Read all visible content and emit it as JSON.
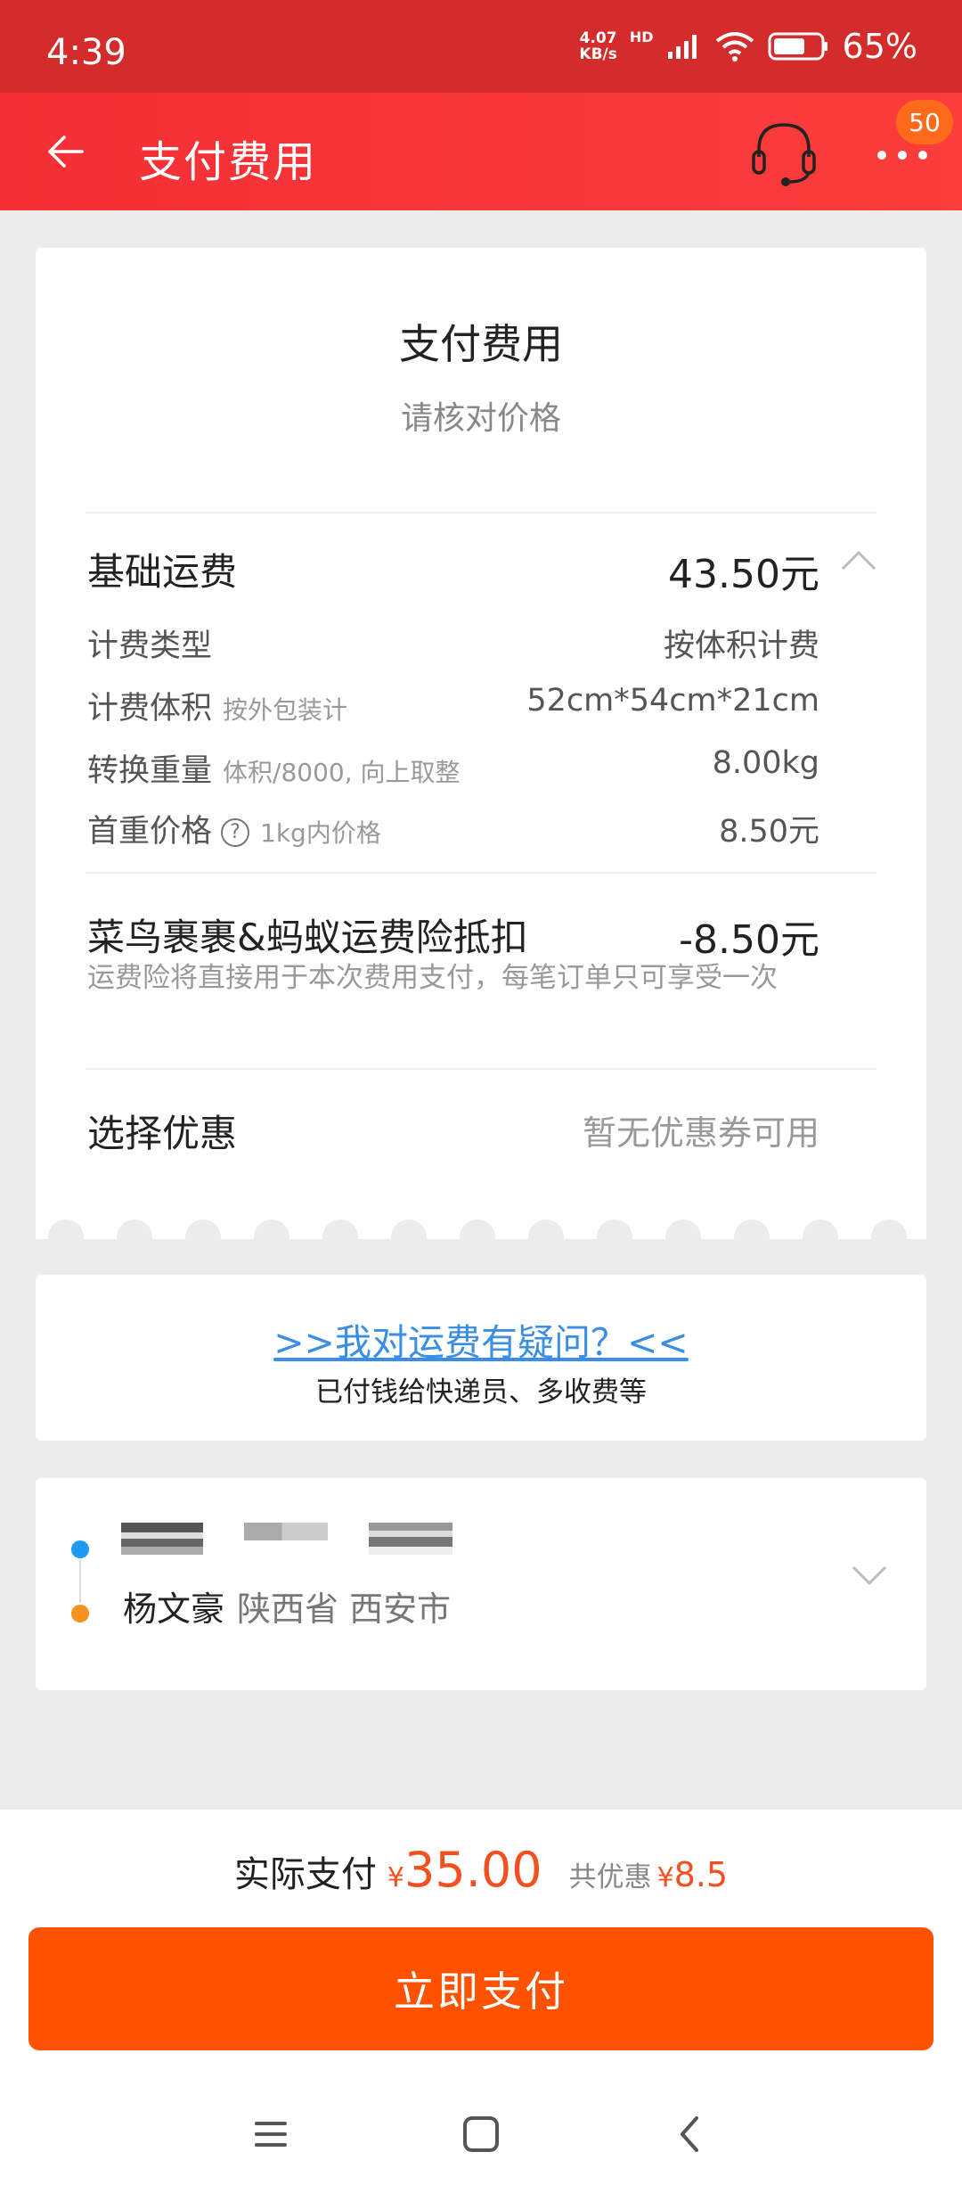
{
  "status_bar": {
    "time": "4:39",
    "net_speed_value": "4.07",
    "net_speed_unit": "KB/s",
    "network_type": "HD",
    "battery": "65%"
  },
  "header": {
    "title": "支付费用",
    "notification_count": "50",
    "background": "#f42f35"
  },
  "fee_card": {
    "title": "支付费用",
    "subtitle": "请核对价格",
    "base_fee": {
      "label": "基础运费",
      "value": "43.50元"
    },
    "details": [
      {
        "label": "计费类型",
        "note": "",
        "value": "按体积计费"
      },
      {
        "label": "计费体积",
        "note": "按外包装计",
        "value": "52cm*54cm*21cm"
      },
      {
        "label": "转换重量",
        "note": "体积/8000, 向上取整",
        "value": "8.00kg"
      },
      {
        "label": "首重价格",
        "note": "1kg内价格",
        "value": "8.50元"
      }
    ],
    "insurance": {
      "label": "菜鸟裹裹&蚂蚁运费险抵扣",
      "value": "-8.50元",
      "description": "运费险将直接用于本次费用支付，每笔订单只可享受一次"
    },
    "coupon": {
      "label": "选择优惠",
      "value": "暂无优惠券可用"
    }
  },
  "question_card": {
    "link": ">>我对运费有疑问？<<",
    "description": "已付钱给快递员、多收费等"
  },
  "address_card": {
    "receiver_name": "杨文豪",
    "receiver_region": "陕西省 西安市"
  },
  "bottom": {
    "actual_pay_label": "实际支付",
    "currency": "¥",
    "actual_pay_amount": "35.00",
    "saved_label": "共优惠",
    "saved_amount": "8.5",
    "pay_button": "立即支付",
    "accent_color": "#ff5200"
  }
}
